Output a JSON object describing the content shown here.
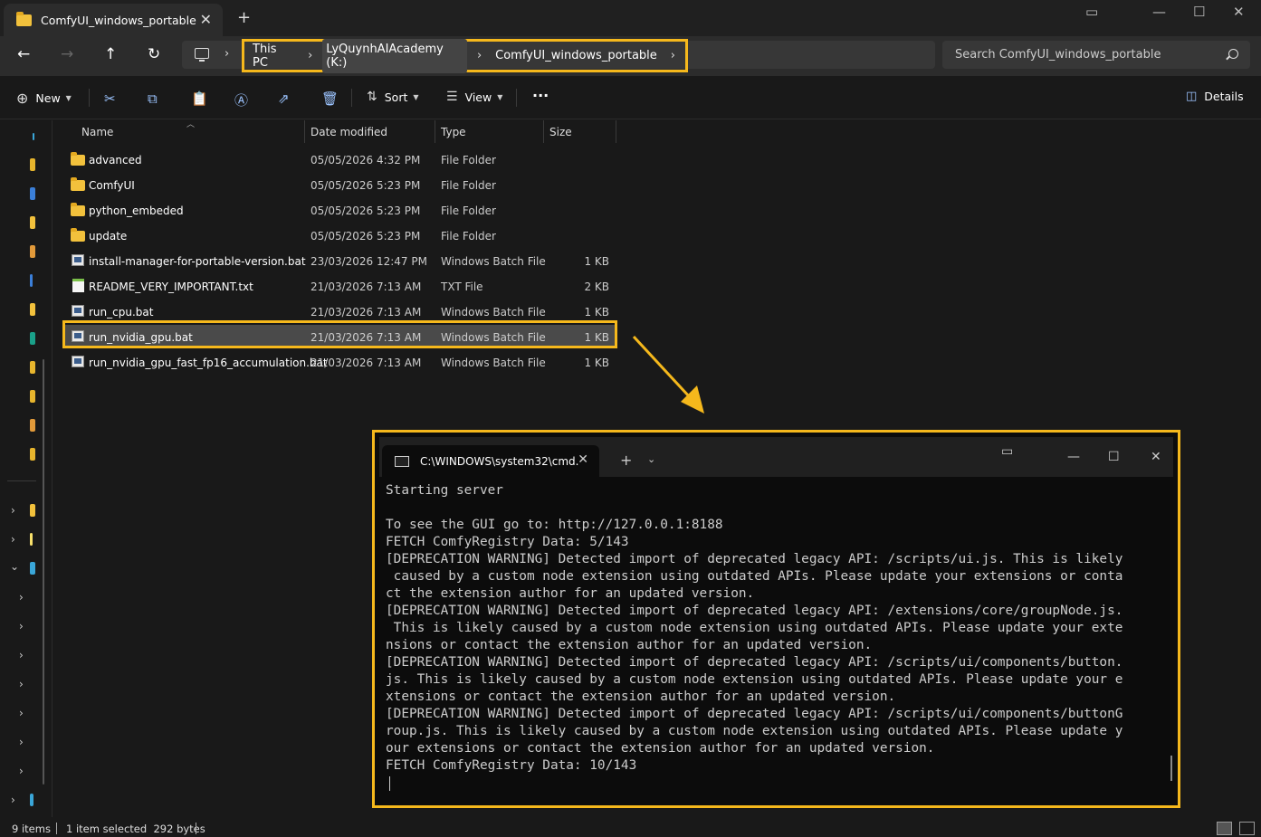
{
  "window": {
    "tab_title": "ComfyUI_windows_portable",
    "close_glyph": "✕",
    "new_tab_glyph": "+"
  },
  "address": {
    "crumbs": [
      "This PC",
      "LyQuynhAIAcademy (K:)",
      "ComfyUI_windows_portable"
    ],
    "search_placeholder": "Search ComfyUI_windows_portable"
  },
  "toolbar": {
    "new_label": "New",
    "sort_label": "Sort",
    "view_label": "View",
    "more_label": "···",
    "details_label": "Details"
  },
  "columns": {
    "name": "Name",
    "date": "Date modified",
    "type": "Type",
    "size": "Size"
  },
  "files": [
    {
      "name": "advanced",
      "date": "05/05/2026 4:32 PM",
      "type": "File Folder",
      "size": "",
      "kind": "folder"
    },
    {
      "name": "ComfyUI",
      "date": "05/05/2026 5:23 PM",
      "type": "File Folder",
      "size": "",
      "kind": "folder"
    },
    {
      "name": "python_embeded",
      "date": "05/05/2026 5:23 PM",
      "type": "File Folder",
      "size": "",
      "kind": "folder"
    },
    {
      "name": "update",
      "date": "05/05/2026 5:23 PM",
      "type": "File Folder",
      "size": "",
      "kind": "folder"
    },
    {
      "name": "install-manager-for-portable-version.bat",
      "date": "23/03/2026 12:47 PM",
      "type": "Windows Batch File",
      "size": "1 KB",
      "kind": "bat"
    },
    {
      "name": "README_VERY_IMPORTANT.txt",
      "date": "21/03/2026 7:13 AM",
      "type": "TXT File",
      "size": "2 KB",
      "kind": "txt"
    },
    {
      "name": "run_cpu.bat",
      "date": "21/03/2026 7:13 AM",
      "type": "Windows Batch File",
      "size": "1 KB",
      "kind": "bat"
    },
    {
      "name": "run_nvidia_gpu.bat",
      "date": "21/03/2026 7:13 AM",
      "type": "Windows Batch File",
      "size": "1 KB",
      "kind": "bat",
      "selected": true
    },
    {
      "name": "run_nvidia_gpu_fast_fp16_accumulation.bat",
      "date": "21/03/2026 7:13 AM",
      "type": "Windows Batch File",
      "size": "1 KB",
      "kind": "bat"
    }
  ],
  "terminal": {
    "tab_title": "C:\\WINDOWS\\system32\\cmd.",
    "lines": [
      "Starting server",
      "",
      "To see the GUI go to: http://127.0.0.1:8188",
      "FETCH ComfyRegistry Data: 5/143",
      "[DEPRECATION WARNING] Detected import of deprecated legacy API: /scripts/ui.js. This is likely",
      " caused by a custom node extension using outdated APIs. Please update your extensions or conta",
      "ct the extension author for an updated version.",
      "[DEPRECATION WARNING] Detected import of deprecated legacy API: /extensions/core/groupNode.js.",
      " This is likely caused by a custom node extension using outdated APIs. Please update your exte",
      "nsions or contact the extension author for an updated version.",
      "[DEPRECATION WARNING] Detected import of deprecated legacy API: /scripts/ui/components/button.",
      "js. This is likely caused by a custom node extension using outdated APIs. Please update your e",
      "xtensions or contact the extension author for an updated version.",
      "[DEPRECATION WARNING] Detected import of deprecated legacy API: /scripts/ui/components/buttonG",
      "roup.js. This is likely caused by a custom node extension using outdated APIs. Please update y",
      "our extensions or contact the extension author for an updated version.",
      "FETCH ComfyRegistry Data: 10/143"
    ]
  },
  "status": {
    "items_count": "9 items",
    "selection": "1 item selected  292 bytes"
  },
  "colors": {
    "highlight": "#f5b81c",
    "folder": "#f2c13c",
    "accent_icon": "#9cc4ff"
  }
}
